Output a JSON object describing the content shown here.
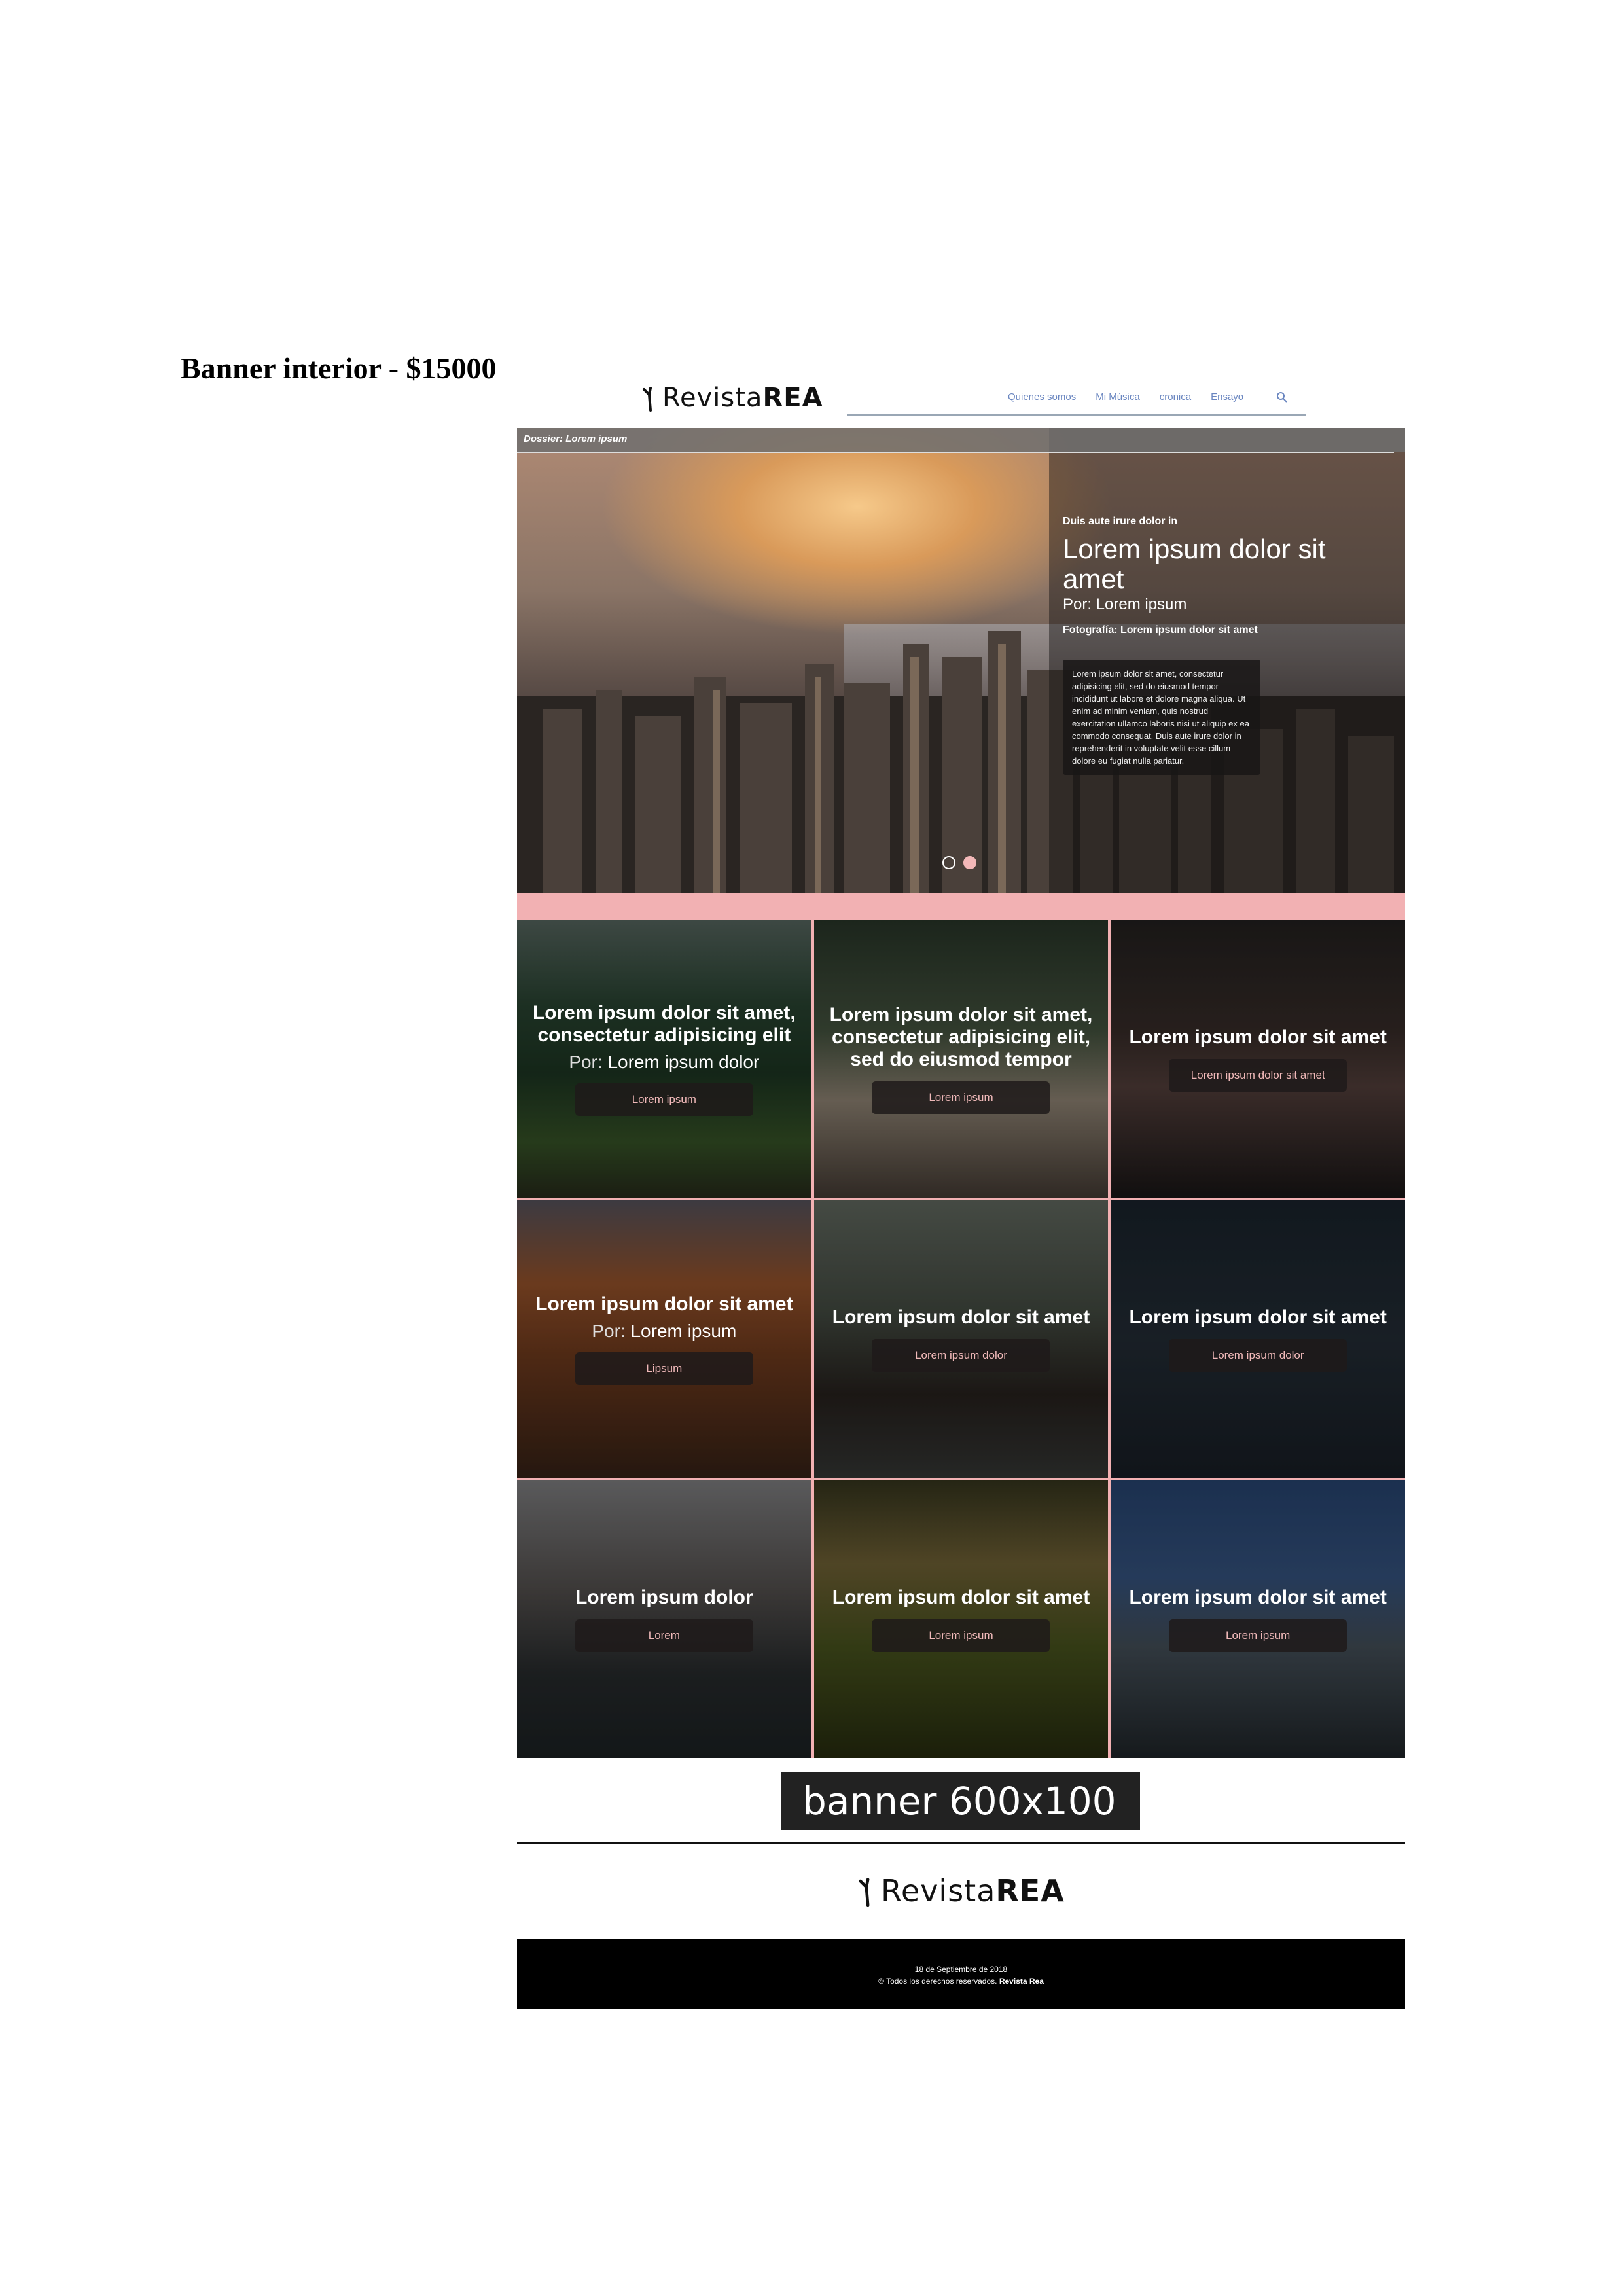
{
  "doc_title": "Banner interior - $15000",
  "header": {
    "logo_light": "Revista",
    "logo_bold": "REA",
    "nav": [
      "Quienes somos",
      "Mi Música",
      "cronica",
      "Ensayo"
    ]
  },
  "hero": {
    "dossier": "Dossier: Lorem ipsum",
    "kicker": "Duis aute irure dolor in",
    "headline": "Lorem ipsum dolor sit amet",
    "byline": "Por: Lorem ipsum",
    "photo_credit": "Fotografía: Lorem ipsum dolor sit amet",
    "excerpt": "Lorem ipsum dolor sit amet, consectetur adipisicing elit, sed do eiusmod tempor incididunt ut labore et dolore magna aliqua. Ut enim ad minim veniam, quis nostrud exercitation ullamco laboris nisi ut aliquip ex ea commodo consequat. Duis aute irure dolor in reprehenderit in voluptate velit esse cillum dolore eu fugiat nulla pariatur."
  },
  "cards": [
    {
      "title": "Lorem ipsum dolor sit amet, consectetur adipisicing elit",
      "by_label": "Por:",
      "by_name": "Lorem ipsum dolor",
      "button": "Lorem ipsum"
    },
    {
      "title": "Lorem ipsum dolor sit amet, consectetur adipisicing elit, sed do eiusmod tempor",
      "button": "Lorem ipsum"
    },
    {
      "title": "Lorem ipsum dolor sit amet",
      "button": "Lorem ipsum dolor sit amet"
    },
    {
      "title": "Lorem ipsum dolor sit amet",
      "by_label": "Por:",
      "by_name": "Lorem ipsum",
      "button": "Lipsum"
    },
    {
      "title": "Lorem ipsum dolor sit amet",
      "button": "Lorem ipsum dolor"
    },
    {
      "title": "Lorem ipsum dolor sit amet",
      "button": "Lorem ipsum dolor"
    },
    {
      "title": "Lorem ipsum dolor",
      "button": "Lorem"
    },
    {
      "title": "Lorem ipsum dolor sit amet",
      "button": "Lorem ipsum"
    },
    {
      "title": "Lorem ipsum dolor sit amet",
      "button": "Lorem ipsum"
    }
  ],
  "banner": "banner 600x100",
  "footer": {
    "logo_light": "Revista",
    "logo_bold": "REA",
    "date": "18 de Septiembre de 2018",
    "rights": "© Todos los derechos reservados.",
    "brand": "Revista Rea"
  },
  "colors": {
    "accent_pink": "#f2b1b3",
    "nav_blue": "#6a86c0"
  }
}
